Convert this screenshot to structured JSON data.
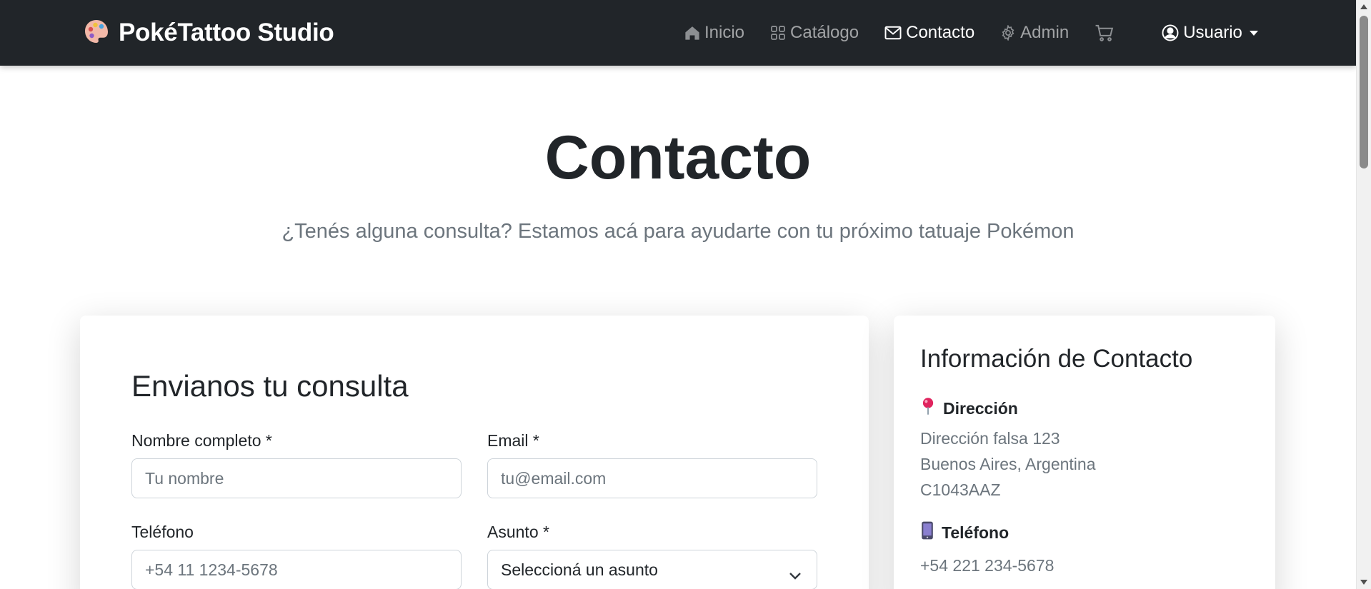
{
  "brand": {
    "name": "PokéTattoo Studio",
    "icon": "palette-icon"
  },
  "nav": {
    "items": [
      {
        "label": "Inicio",
        "icon": "house-icon",
        "active": false
      },
      {
        "label": "Catálogo",
        "icon": "grid-icon",
        "active": false
      },
      {
        "label": "Contacto",
        "icon": "envelope-icon",
        "active": true
      },
      {
        "label": "Admin",
        "icon": "gear-icon",
        "active": false
      }
    ],
    "cart_icon": "cart-icon",
    "user": {
      "label": "Usuario",
      "icon": "person-circle-icon"
    }
  },
  "header": {
    "title": "Contacto",
    "subtitle": "¿Tenés alguna consulta? Estamos acá para ayudarte con tu próximo tatuaje Pokémon"
  },
  "form": {
    "title": "Envianos tu consulta",
    "name": {
      "label": "Nombre completo *",
      "placeholder": "Tu nombre",
      "value": ""
    },
    "email": {
      "label": "Email *",
      "placeholder": "tu@email.com",
      "value": ""
    },
    "phone": {
      "label": "Teléfono",
      "placeholder": "+54 11 1234-5678",
      "value": ""
    },
    "subject": {
      "label": "Asunto *",
      "selected": "Seleccioná un asunto"
    }
  },
  "info": {
    "title": "Información de Contacto",
    "address": {
      "label": "Dirección",
      "icon": "pin-icon",
      "lines": [
        "Dirección falsa 123",
        "Buenos Aires, Argentina",
        "C1043AAZ"
      ]
    },
    "phone": {
      "label": "Teléfono",
      "icon": "mobile-phone-icon",
      "value": "+54 221 234-5678"
    }
  },
  "colors": {
    "navbar_bg": "#212529",
    "nav_inactive": "#8c8f92",
    "text_dark": "#212529",
    "text_muted": "#6c757d"
  }
}
